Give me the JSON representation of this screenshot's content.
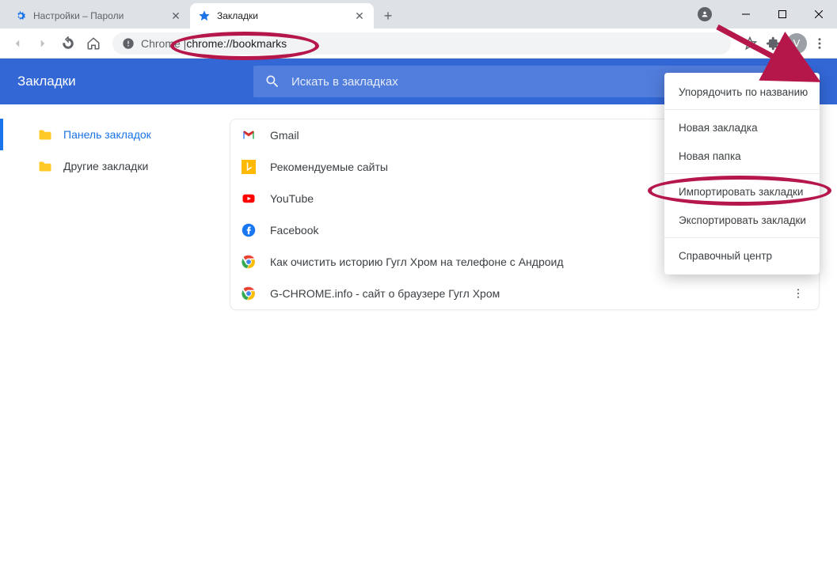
{
  "tabs": [
    {
      "title": "Настройки – Пароли",
      "active": false
    },
    {
      "title": "Закладки",
      "active": true
    }
  ],
  "omnibox": {
    "prefix": "Chrome | ",
    "url": "chrome://bookmarks"
  },
  "avatar_letter": "V",
  "app": {
    "title": "Закладки"
  },
  "search": {
    "placeholder": "Искать в закладках"
  },
  "sidebar": [
    {
      "label": "Панель закладок",
      "selected": true
    },
    {
      "label": "Другие закладки",
      "selected": false
    }
  ],
  "bookmarks": [
    {
      "title": "Gmail",
      "icon": "gmail"
    },
    {
      "title": "Рекомендуемые сайты",
      "icon": "bing"
    },
    {
      "title": "YouTube",
      "icon": "youtube"
    },
    {
      "title": "Facebook",
      "icon": "facebook"
    },
    {
      "title": "Как очистить историю Гугл Хром на телефоне с Андроид",
      "icon": "chrome"
    },
    {
      "title": "G-CHROME.info - сайт о браузере Гугл Хром",
      "icon": "chrome"
    }
  ],
  "menu": {
    "sort": "Упорядочить по названию",
    "new_bookmark": "Новая закладка",
    "new_folder": "Новая папка",
    "import": "Импортировать закладки",
    "export": "Экспортировать закладки",
    "help": "Справочный центр"
  }
}
